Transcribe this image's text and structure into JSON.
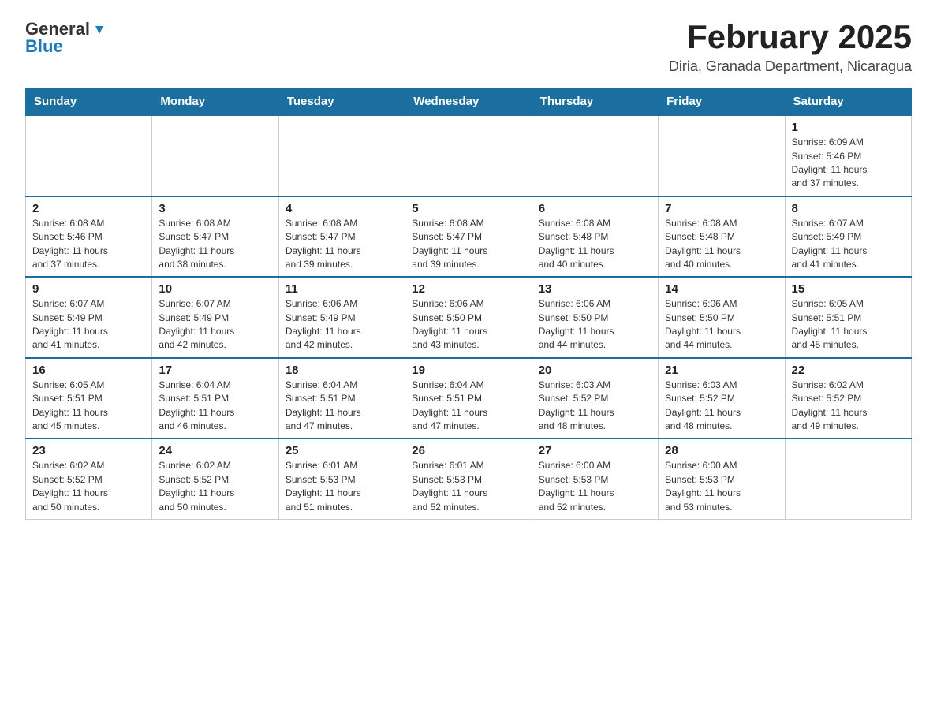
{
  "logo": {
    "general_text": "General",
    "blue_text": "Blue"
  },
  "header": {
    "title": "February 2025",
    "subtitle": "Diria, Granada Department, Nicaragua"
  },
  "days_of_week": [
    "Sunday",
    "Monday",
    "Tuesday",
    "Wednesday",
    "Thursday",
    "Friday",
    "Saturday"
  ],
  "weeks": [
    [
      {
        "day": "",
        "info": ""
      },
      {
        "day": "",
        "info": ""
      },
      {
        "day": "",
        "info": ""
      },
      {
        "day": "",
        "info": ""
      },
      {
        "day": "",
        "info": ""
      },
      {
        "day": "",
        "info": ""
      },
      {
        "day": "1",
        "info": "Sunrise: 6:09 AM\nSunset: 5:46 PM\nDaylight: 11 hours\nand 37 minutes."
      }
    ],
    [
      {
        "day": "2",
        "info": "Sunrise: 6:08 AM\nSunset: 5:46 PM\nDaylight: 11 hours\nand 37 minutes."
      },
      {
        "day": "3",
        "info": "Sunrise: 6:08 AM\nSunset: 5:47 PM\nDaylight: 11 hours\nand 38 minutes."
      },
      {
        "day": "4",
        "info": "Sunrise: 6:08 AM\nSunset: 5:47 PM\nDaylight: 11 hours\nand 39 minutes."
      },
      {
        "day": "5",
        "info": "Sunrise: 6:08 AM\nSunset: 5:47 PM\nDaylight: 11 hours\nand 39 minutes."
      },
      {
        "day": "6",
        "info": "Sunrise: 6:08 AM\nSunset: 5:48 PM\nDaylight: 11 hours\nand 40 minutes."
      },
      {
        "day": "7",
        "info": "Sunrise: 6:08 AM\nSunset: 5:48 PM\nDaylight: 11 hours\nand 40 minutes."
      },
      {
        "day": "8",
        "info": "Sunrise: 6:07 AM\nSunset: 5:49 PM\nDaylight: 11 hours\nand 41 minutes."
      }
    ],
    [
      {
        "day": "9",
        "info": "Sunrise: 6:07 AM\nSunset: 5:49 PM\nDaylight: 11 hours\nand 41 minutes."
      },
      {
        "day": "10",
        "info": "Sunrise: 6:07 AM\nSunset: 5:49 PM\nDaylight: 11 hours\nand 42 minutes."
      },
      {
        "day": "11",
        "info": "Sunrise: 6:06 AM\nSunset: 5:49 PM\nDaylight: 11 hours\nand 42 minutes."
      },
      {
        "day": "12",
        "info": "Sunrise: 6:06 AM\nSunset: 5:50 PM\nDaylight: 11 hours\nand 43 minutes."
      },
      {
        "day": "13",
        "info": "Sunrise: 6:06 AM\nSunset: 5:50 PM\nDaylight: 11 hours\nand 44 minutes."
      },
      {
        "day": "14",
        "info": "Sunrise: 6:06 AM\nSunset: 5:50 PM\nDaylight: 11 hours\nand 44 minutes."
      },
      {
        "day": "15",
        "info": "Sunrise: 6:05 AM\nSunset: 5:51 PM\nDaylight: 11 hours\nand 45 minutes."
      }
    ],
    [
      {
        "day": "16",
        "info": "Sunrise: 6:05 AM\nSunset: 5:51 PM\nDaylight: 11 hours\nand 45 minutes."
      },
      {
        "day": "17",
        "info": "Sunrise: 6:04 AM\nSunset: 5:51 PM\nDaylight: 11 hours\nand 46 minutes."
      },
      {
        "day": "18",
        "info": "Sunrise: 6:04 AM\nSunset: 5:51 PM\nDaylight: 11 hours\nand 47 minutes."
      },
      {
        "day": "19",
        "info": "Sunrise: 6:04 AM\nSunset: 5:51 PM\nDaylight: 11 hours\nand 47 minutes."
      },
      {
        "day": "20",
        "info": "Sunrise: 6:03 AM\nSunset: 5:52 PM\nDaylight: 11 hours\nand 48 minutes."
      },
      {
        "day": "21",
        "info": "Sunrise: 6:03 AM\nSunset: 5:52 PM\nDaylight: 11 hours\nand 48 minutes."
      },
      {
        "day": "22",
        "info": "Sunrise: 6:02 AM\nSunset: 5:52 PM\nDaylight: 11 hours\nand 49 minutes."
      }
    ],
    [
      {
        "day": "23",
        "info": "Sunrise: 6:02 AM\nSunset: 5:52 PM\nDaylight: 11 hours\nand 50 minutes."
      },
      {
        "day": "24",
        "info": "Sunrise: 6:02 AM\nSunset: 5:52 PM\nDaylight: 11 hours\nand 50 minutes."
      },
      {
        "day": "25",
        "info": "Sunrise: 6:01 AM\nSunset: 5:53 PM\nDaylight: 11 hours\nand 51 minutes."
      },
      {
        "day": "26",
        "info": "Sunrise: 6:01 AM\nSunset: 5:53 PM\nDaylight: 11 hours\nand 52 minutes."
      },
      {
        "day": "27",
        "info": "Sunrise: 6:00 AM\nSunset: 5:53 PM\nDaylight: 11 hours\nand 52 minutes."
      },
      {
        "day": "28",
        "info": "Sunrise: 6:00 AM\nSunset: 5:53 PM\nDaylight: 11 hours\nand 53 minutes."
      },
      {
        "day": "",
        "info": ""
      }
    ]
  ]
}
